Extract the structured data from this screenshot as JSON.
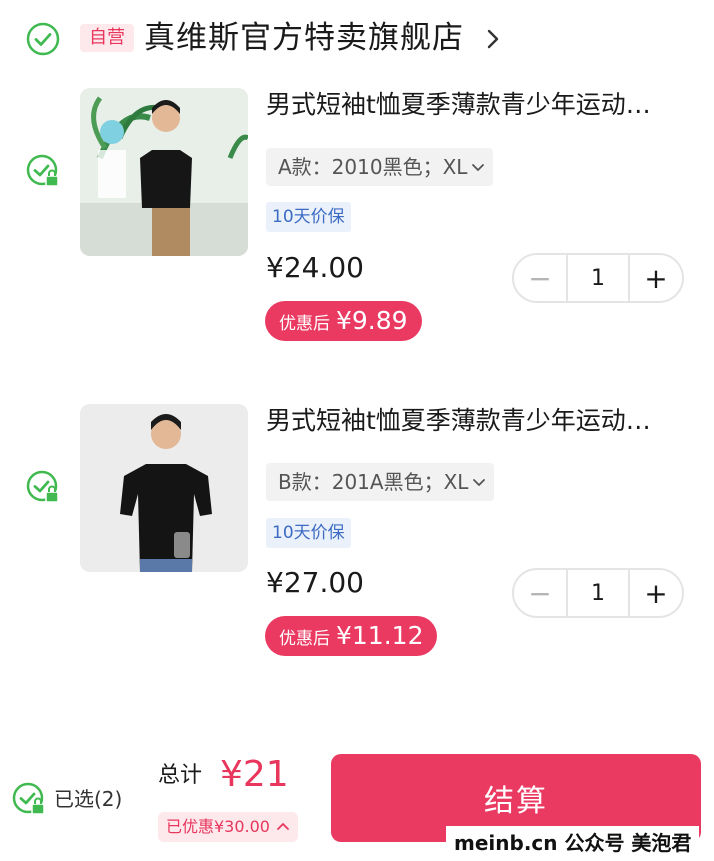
{
  "store": {
    "badge": "自营",
    "name": "真维斯官方特卖旗舰店"
  },
  "items": [
    {
      "title": "男式短袖t恤夏季薄款青少年运动…",
      "sku": "A款：2010黑色；XL",
      "protection": "10天价保",
      "price": "¥24.00",
      "deal_label": "优惠后",
      "deal_price": "¥9.89",
      "quantity": "1"
    },
    {
      "title": "男式短袖t恤夏季薄款青少年运动…",
      "sku": "B款：201A黑色；XL",
      "protection": "10天价保",
      "price": "¥27.00",
      "deal_label": "优惠后",
      "deal_price": "¥11.12",
      "quantity": "1"
    }
  ],
  "footer": {
    "selected": "已选(2)",
    "total_label": "总计",
    "total_value": "¥21",
    "saved": "已优惠¥30.00",
    "checkout": "结算"
  },
  "watermark": "meinb.cn  公众号 美泡君",
  "colors": {
    "accent": "#ea3a62",
    "check_green": "#3fb950",
    "protect_blue": "#3d6bc3"
  },
  "icons": [
    "check-circle-icon",
    "check-lock-icon",
    "chevron-right-icon",
    "chevron-down-icon",
    "minus-icon",
    "plus-icon",
    "chevron-up-icon"
  ]
}
